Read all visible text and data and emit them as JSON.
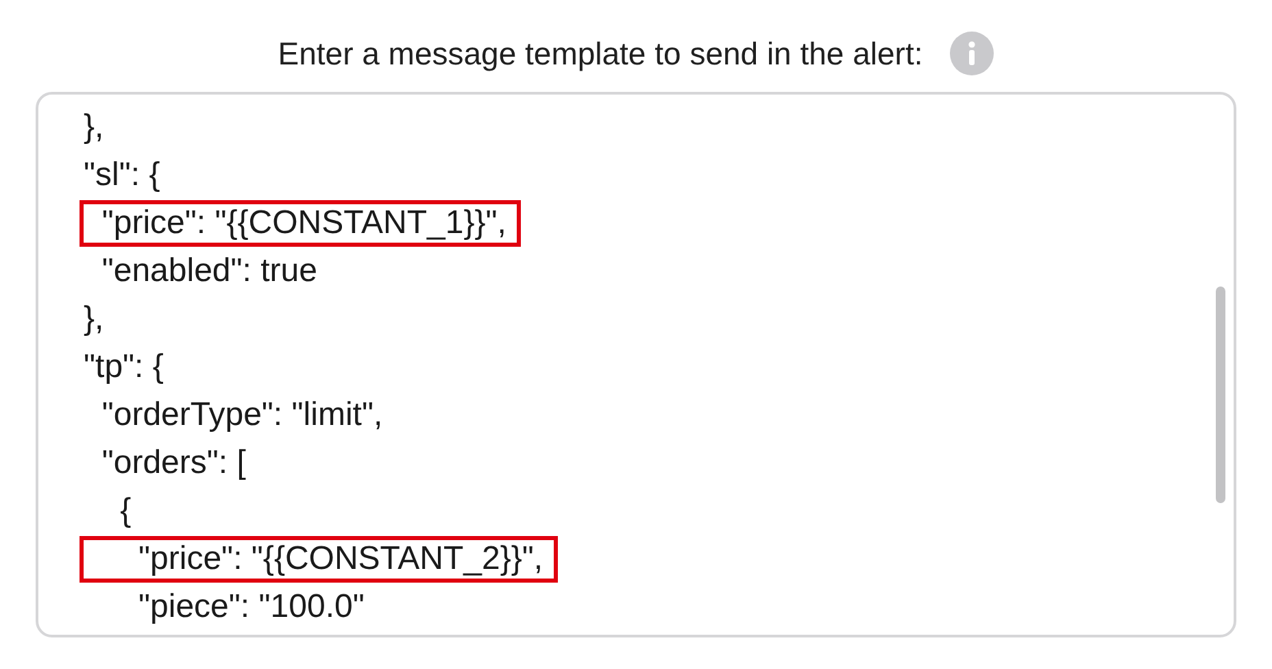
{
  "label": "Enter a message template to send in the alert:",
  "template_lines": [
    {
      "text": "},",
      "highlighted": false
    },
    {
      "text": "\"sl\": {",
      "highlighted": false
    },
    {
      "text": "  \"price\": \"{{CONSTANT_1}}\",",
      "highlighted": true
    },
    {
      "text": "  \"enabled\": true",
      "highlighted": false
    },
    {
      "text": "},",
      "highlighted": false
    },
    {
      "text": "\"tp\": {",
      "highlighted": false
    },
    {
      "text": "  \"orderType\": \"limit\",",
      "highlighted": false
    },
    {
      "text": "  \"orders\": [",
      "highlighted": false
    },
    {
      "text": "    {",
      "highlighted": false
    },
    {
      "text": "      \"price\": \"{{CONSTANT_2}}\",",
      "highlighted": true
    },
    {
      "text": "      \"piece\": \"100.0\"",
      "highlighted": false
    }
  ]
}
